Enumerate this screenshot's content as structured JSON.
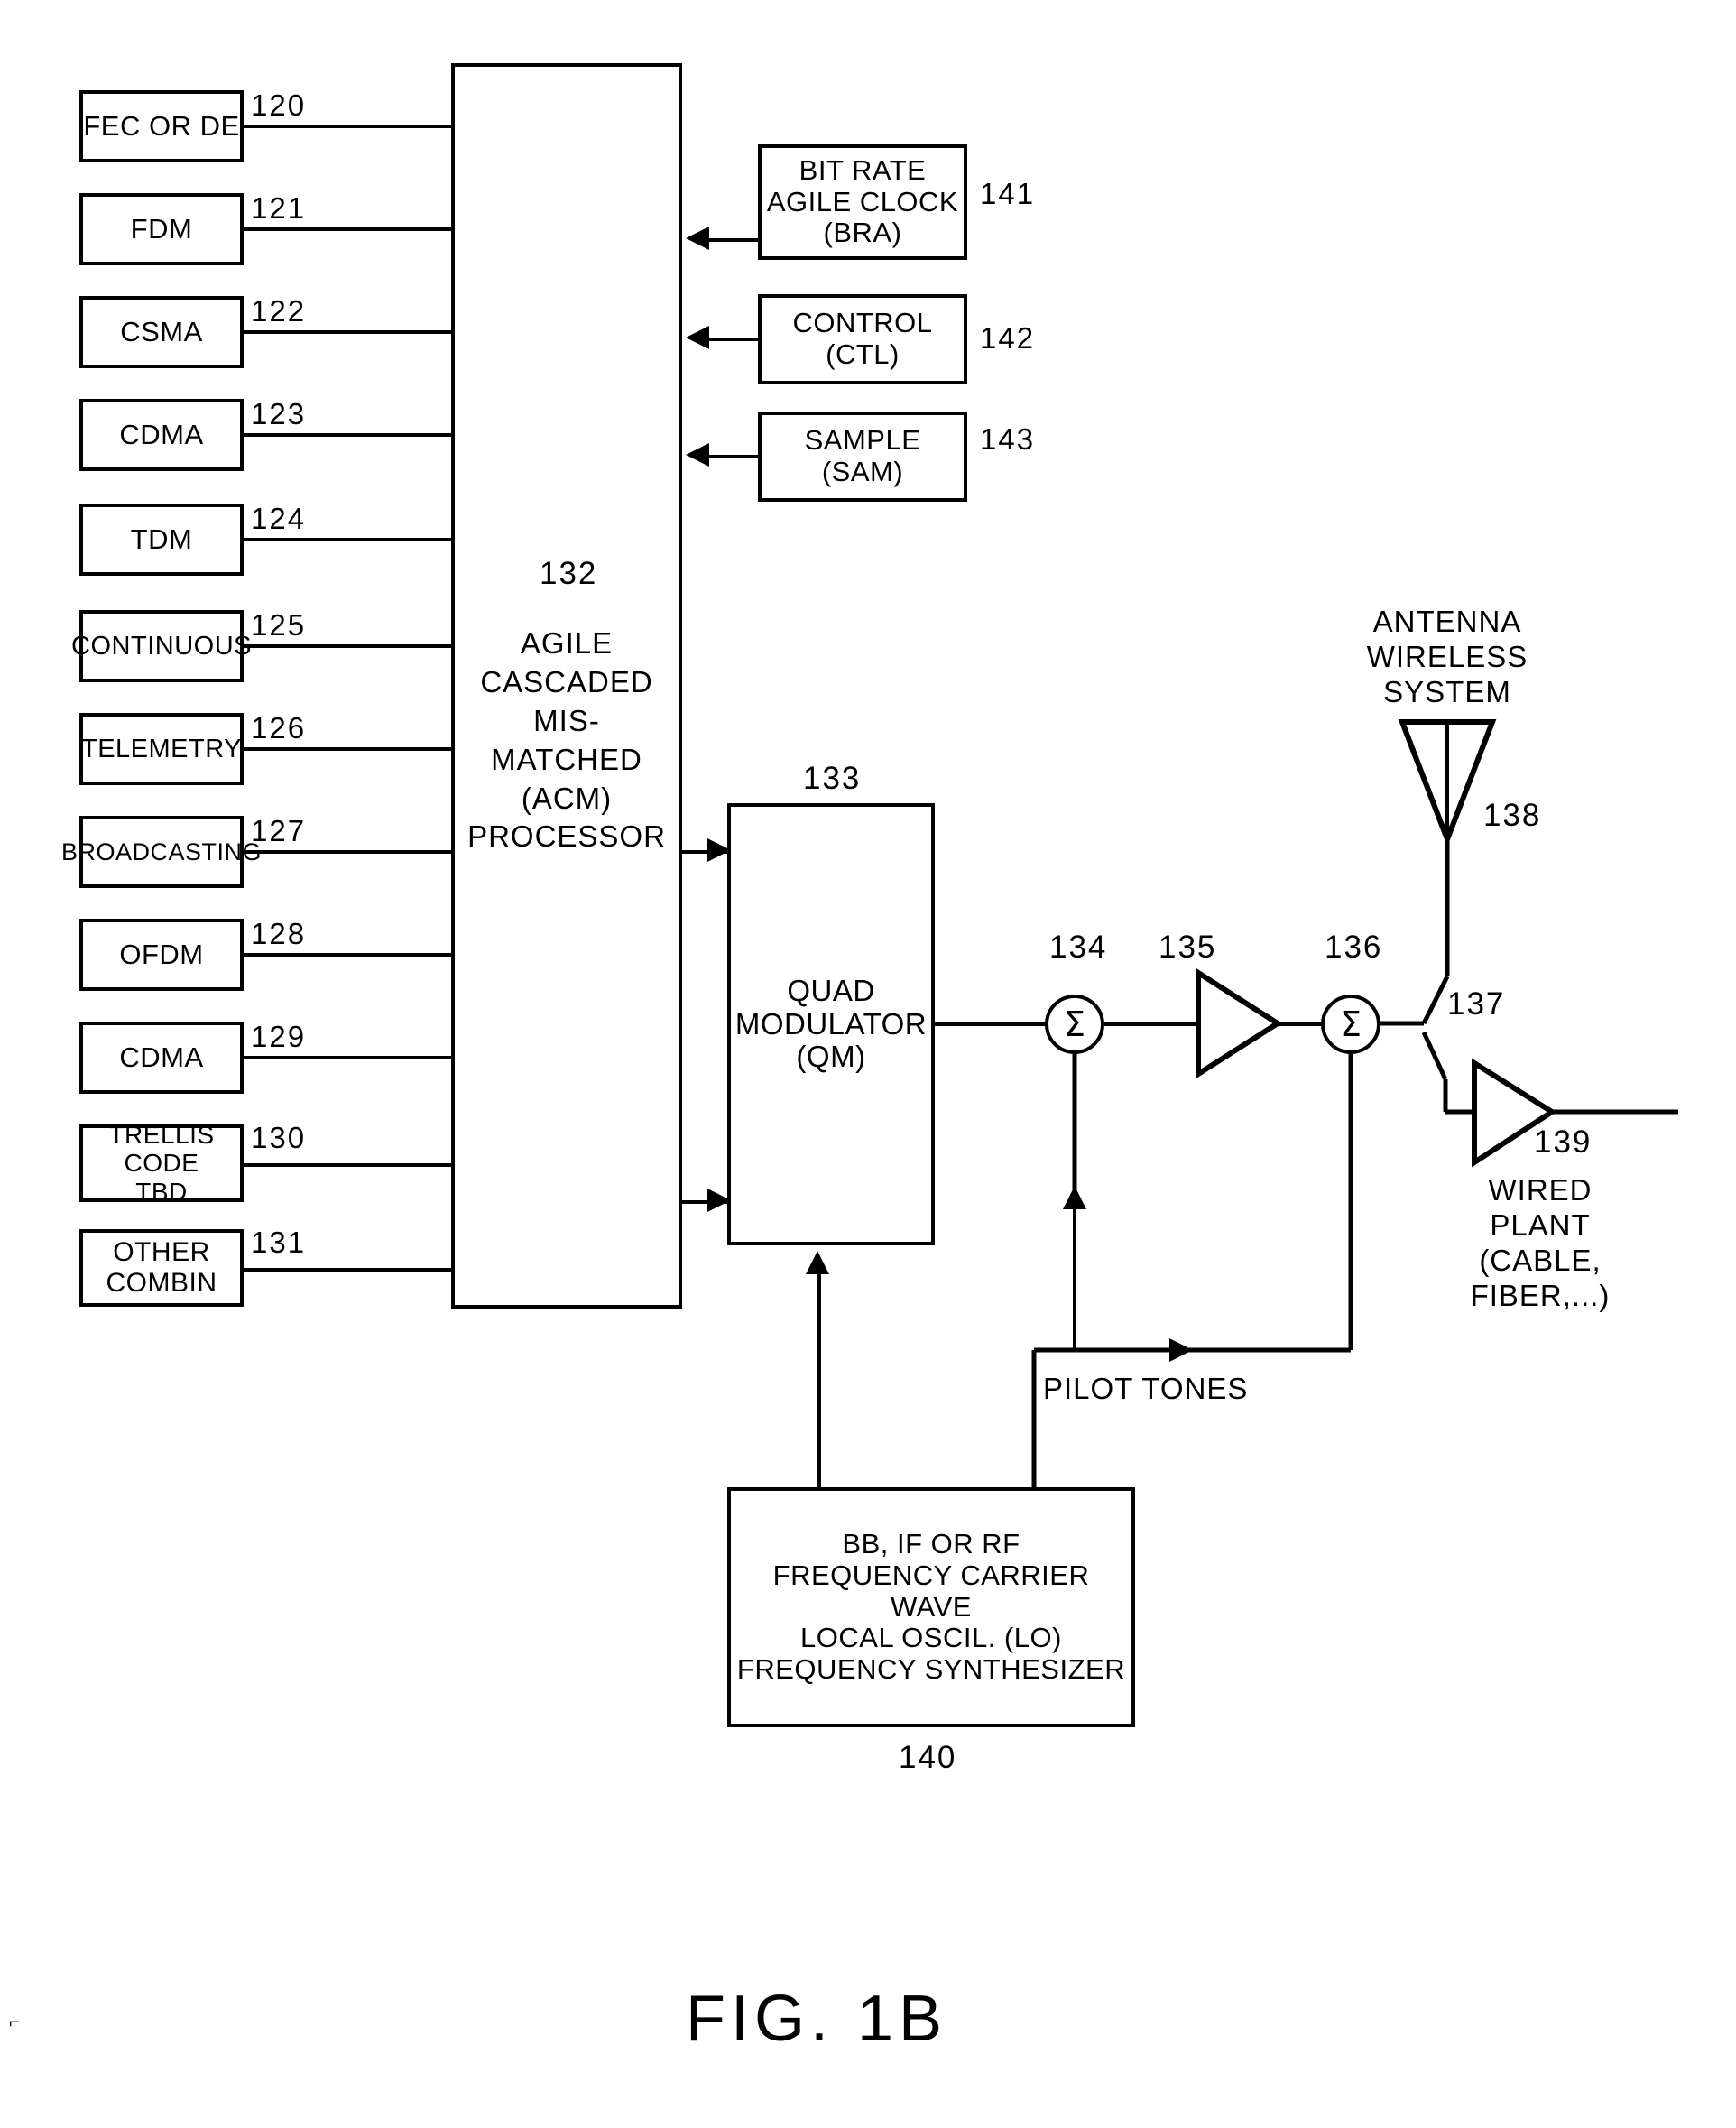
{
  "figure": {
    "caption": "FIG. 1B"
  },
  "input_blocks": [
    {
      "label": "FEC OR DE",
      "ref": "120"
    },
    {
      "label": "FDM",
      "ref": "121"
    },
    {
      "label": "CSMA",
      "ref": "122"
    },
    {
      "label": "CDMA",
      "ref": "123"
    },
    {
      "label": "TDM",
      "ref": "124"
    },
    {
      "label": "CONTINUOUS",
      "ref": "125"
    },
    {
      "label": "TELEMETRY",
      "ref": "126"
    },
    {
      "label": "BROADCASTING",
      "ref": "127"
    },
    {
      "label": "OFDM",
      "ref": "128"
    },
    {
      "label": "CDMA",
      "ref": "129"
    },
    {
      "label": "TRELLIS CODE\nTBD",
      "ref": "130"
    },
    {
      "label": "OTHER\nCOMBIN",
      "ref": "131"
    }
  ],
  "processor": {
    "ref": "132",
    "label": "AGILE\nCASCADED\nMIS-MATCHED\n(ACM)\nPROCESSOR"
  },
  "control_blocks": [
    {
      "label": "BIT RATE\nAGILE CLOCK\n(BRA)",
      "ref": "141"
    },
    {
      "label": "CONTROL\n(CTL)",
      "ref": "142"
    },
    {
      "label": "SAMPLE\n(SAM)",
      "ref": "143"
    }
  ],
  "modulator": {
    "ref": "133",
    "label": "QUAD\nMODULATOR\n(QM)"
  },
  "chain": {
    "summer1": {
      "ref": "134",
      "symbol": "Σ"
    },
    "amplifier1": {
      "ref": "135"
    },
    "summer2": {
      "ref": "136",
      "symbol": "Σ"
    },
    "splitter": {
      "ref": "137"
    },
    "amplifier2": {
      "ref": "139"
    }
  },
  "antenna": {
    "ref": "138",
    "label": "ANTENNA\nWIRELESS\nSYSTEM"
  },
  "wired_plant": {
    "ref": "139",
    "label": "WIRED\nPLANT\n(CABLE,\nFIBER,...)"
  },
  "pilot_tones": {
    "label": "PILOT TONES"
  },
  "local_oscillator": {
    "ref": "140",
    "label": "BB, IF OR RF\nFREQUENCY CARRIER WAVE\nLOCAL OSCIL. (LO)\nFREQUENCY SYNTHESIZER"
  }
}
